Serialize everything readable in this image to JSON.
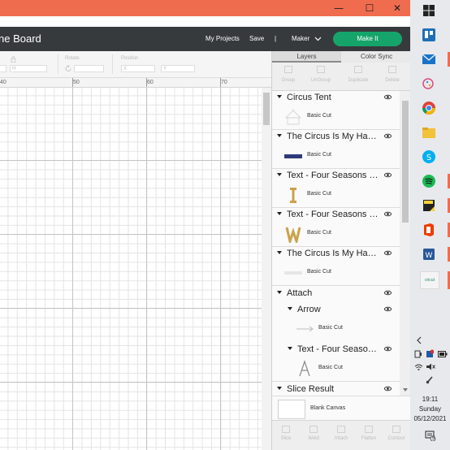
{
  "window": {
    "minimize": "—",
    "maximize": "☐",
    "close": "✕"
  },
  "header": {
    "project_title": "ne Board",
    "my_projects": "My Projects",
    "save": "Save",
    "separator": "|",
    "machine": "Maker",
    "make_it": "Make It"
  },
  "toolbar": {
    "size_w_placeholder": "W",
    "size_h_placeholder": "H",
    "rotate_label": "Rotate",
    "position_label": "Position",
    "x_placeholder": "X",
    "y_placeholder": "Y"
  },
  "ruler": {
    "ticks": [
      "40",
      "50",
      "60",
      "70"
    ]
  },
  "panel": {
    "tabs": [
      {
        "label": "Layers",
        "active": true
      },
      {
        "label": "Color Sync",
        "active": false
      }
    ],
    "ops_top": [
      "Group",
      "UnGroup",
      "Duplicate",
      "Delete"
    ],
    "ops_bottom": [
      "Slice",
      "Weld",
      "Attach",
      "Flatten",
      "Contour"
    ],
    "blank_canvas": "Blank Canvas"
  },
  "layers": [
    {
      "name": "Circus Tent",
      "cut": "Basic Cut",
      "thumb": "tent-icon"
    },
    {
      "name": "The Circus Is My Happy Place",
      "cut": "Basic Cut",
      "thumb": "circus-text-thumb"
    },
    {
      "name": "Text - Four Seasons Happy",
      "cut": "Basic Cut",
      "thumb": "letter-i-thumb"
    },
    {
      "name": "Text - Four Seasons Happy",
      "cut": "Basic Cut",
      "thumb": "letter-w-thumb"
    },
    {
      "name": "The Circus Is My Happy Place",
      "cut": "Basic Cut",
      "thumb": "faint-text-thumb"
    },
    {
      "name": "Attach",
      "group": true
    },
    {
      "name": "Arrow",
      "cut": "Basic Cut",
      "thumb": "arrow-thumb",
      "indent": true
    },
    {
      "name": "Text - Four Seasons Happy",
      "cut": "Basic Cut",
      "thumb": "letter-a-thumb",
      "indent": true
    },
    {
      "name": "Slice Result",
      "group": true
    }
  ],
  "taskbar": {
    "time": "19:11",
    "day": "Sunday",
    "date": "05/12/2021",
    "notifications": "5",
    "cricut_label": "cricut"
  },
  "colors": {
    "titlebar": "#ef6c4f",
    "header_bg": "#373a3d",
    "make_it": "#15a56b"
  }
}
